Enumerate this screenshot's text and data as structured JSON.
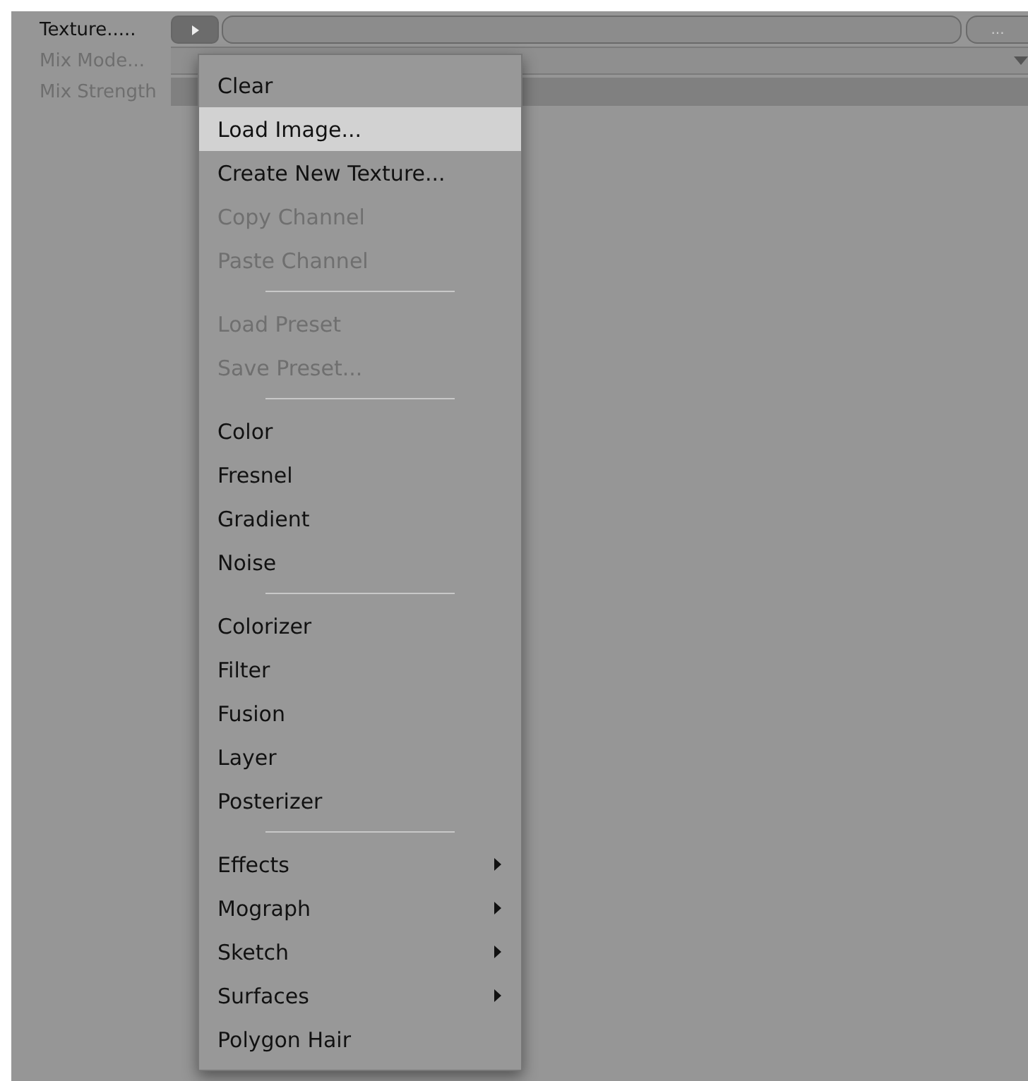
{
  "fields": [
    {
      "label": "Texture.....",
      "disabled": false,
      "kind": "texture",
      "button": "..."
    },
    {
      "label": "Mix Mode...",
      "disabled": true,
      "kind": "dropdown"
    },
    {
      "label": "Mix Strength",
      "disabled": true,
      "kind": "slider"
    }
  ],
  "menu": [
    {
      "kind": "item",
      "label": "Clear",
      "disabled": false,
      "selected": false
    },
    {
      "kind": "item",
      "label": "Load Image...",
      "disabled": false,
      "selected": true
    },
    {
      "kind": "item",
      "label": "Create New Texture...",
      "disabled": false,
      "selected": false
    },
    {
      "kind": "item",
      "label": "Copy Channel",
      "disabled": true,
      "selected": false
    },
    {
      "kind": "item",
      "label": "Paste Channel",
      "disabled": true,
      "selected": false
    },
    {
      "kind": "separator"
    },
    {
      "kind": "item",
      "label": "Load Preset",
      "disabled": true,
      "selected": false
    },
    {
      "kind": "item",
      "label": "Save Preset...",
      "disabled": true,
      "selected": false
    },
    {
      "kind": "separator"
    },
    {
      "kind": "item",
      "label": "Color",
      "disabled": false,
      "selected": false
    },
    {
      "kind": "item",
      "label": "Fresnel",
      "disabled": false,
      "selected": false
    },
    {
      "kind": "item",
      "label": "Gradient",
      "disabled": false,
      "selected": false
    },
    {
      "kind": "item",
      "label": "Noise",
      "disabled": false,
      "selected": false
    },
    {
      "kind": "separator"
    },
    {
      "kind": "item",
      "label": "Colorizer",
      "disabled": false,
      "selected": false
    },
    {
      "kind": "item",
      "label": "Filter",
      "disabled": false,
      "selected": false
    },
    {
      "kind": "item",
      "label": "Fusion",
      "disabled": false,
      "selected": false
    },
    {
      "kind": "item",
      "label": "Layer",
      "disabled": false,
      "selected": false
    },
    {
      "kind": "item",
      "label": "Posterizer",
      "disabled": false,
      "selected": false
    },
    {
      "kind": "separator"
    },
    {
      "kind": "submenu",
      "label": "Effects",
      "disabled": false,
      "selected": false
    },
    {
      "kind": "submenu",
      "label": "Mograph",
      "disabled": false,
      "selected": false
    },
    {
      "kind": "submenu",
      "label": "Sketch",
      "disabled": false,
      "selected": false
    },
    {
      "kind": "submenu",
      "label": "Surfaces",
      "disabled": false,
      "selected": false
    },
    {
      "kind": "item",
      "label": "Polygon Hair",
      "disabled": false,
      "selected": false
    }
  ]
}
